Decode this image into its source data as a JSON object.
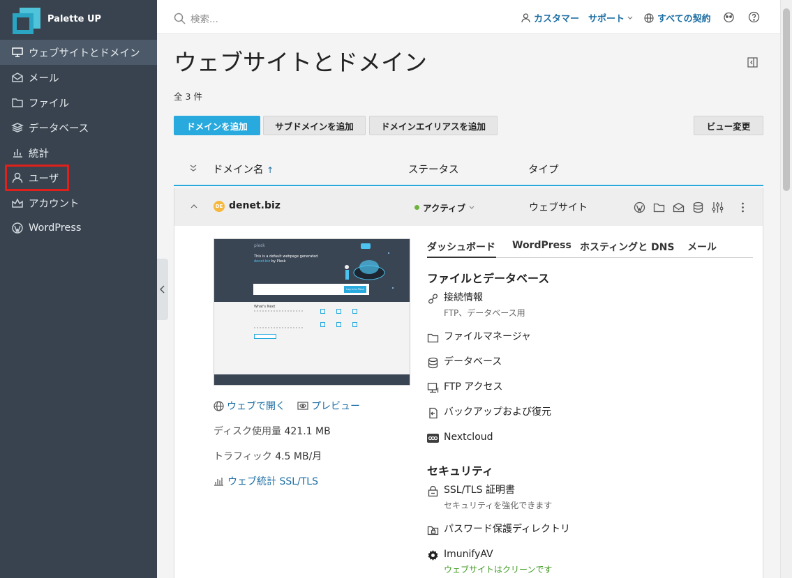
{
  "app": {
    "brand": "Palette UP"
  },
  "colors": {
    "sidebar": "#38434f",
    "accent": "#28aade",
    "link": "#1c6ea4",
    "highlight": "#e0201a",
    "active_status": "#6cb33e"
  },
  "nav": {
    "items": [
      {
        "label": "ウェブサイトとドメイン",
        "icon": "monitor-icon"
      },
      {
        "label": "メール",
        "icon": "mail-icon"
      },
      {
        "label": "ファイル",
        "icon": "folder-icon"
      },
      {
        "label": "データベース",
        "icon": "database-icon"
      },
      {
        "label": "統計",
        "icon": "chart-icon"
      },
      {
        "label": "ユーザ",
        "icon": "user-icon"
      },
      {
        "label": "アカウント",
        "icon": "account-icon"
      },
      {
        "label": "WordPress",
        "icon": "wordpress-icon"
      }
    ]
  },
  "topbar": {
    "search_placeholder": "検索...",
    "customer_support": "カスタマー　サポート",
    "all_subscriptions": "すべての契約"
  },
  "page": {
    "title": "ウェブサイトとドメイン",
    "count": "全 3 件"
  },
  "buttons": {
    "add_domain": "ドメインを追加",
    "add_subdomain": "サブドメインを追加",
    "add_alias": "ドメインエイリアスを追加",
    "change_view": "ビュー変更"
  },
  "table": {
    "col_name": "ドメイン名",
    "sort_arrow": "↑",
    "col_status": "ステータス",
    "col_type": "タイプ"
  },
  "domain": {
    "badge": "DE",
    "name": "denet.biz",
    "status": "アクティブ",
    "type": "ウェブサイト",
    "open_web": "ウェブで開く",
    "preview": "プレビュー",
    "disk_label": "ディスク使用量",
    "disk_value": "421.1 MB",
    "traffic_label": "トラフィック",
    "traffic_value": "4.5 MB/月",
    "stats_link": "ウェブ統計 SSL/TLS"
  },
  "preview_page": {
    "logo": "plesk",
    "heading": "This is a default webpage generated",
    "link_word": "denet.biz",
    "suffix": "by Plesk",
    "login": "Log in to Plesk",
    "whats_next": "What's Next"
  },
  "tabs": [
    "ダッシュボード",
    "WordPress",
    "ホスティングと DNS",
    "メール"
  ],
  "sections": {
    "files_db": "ファイルとデータベース",
    "security": "セキュリティ"
  },
  "tools": [
    {
      "label": "接続情報",
      "sub": "FTP、データベース用",
      "icon": "link-icon"
    },
    {
      "label": "ファイルマネージャ",
      "icon": "folder-icon"
    },
    {
      "label": "データベース",
      "icon": "database-icon"
    },
    {
      "label": "FTP アクセス",
      "icon": "ftp-icon"
    },
    {
      "label": "バックアップおよび復元",
      "icon": "backup-icon"
    },
    {
      "label": "Nextcloud",
      "icon": "nextcloud-icon"
    },
    {
      "label": "SSL/TLS 証明書",
      "sub": "セキュリティを強化できます",
      "icon": "lock-icon"
    },
    {
      "label": "パスワード保護ディレクトリ",
      "icon": "protected-folder-icon"
    },
    {
      "label": "ImunifyAV",
      "sub": "ウェブサイトはクリーンです",
      "icon": "gear-icon"
    }
  ]
}
